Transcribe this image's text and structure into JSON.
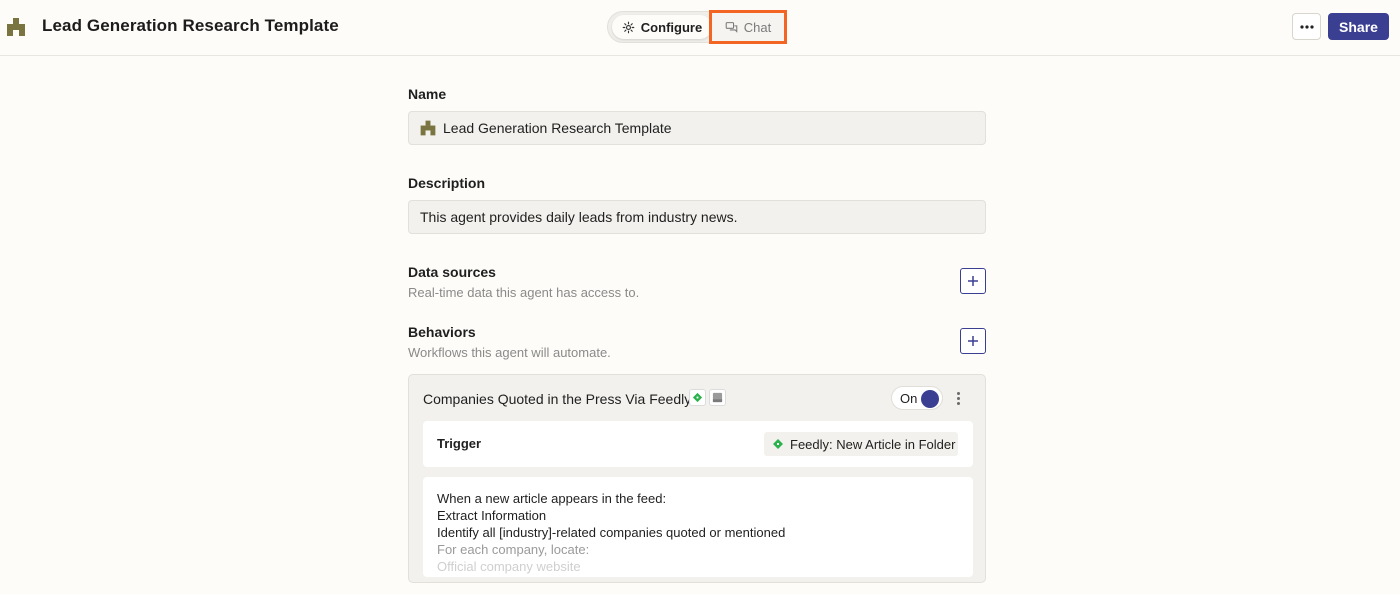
{
  "header": {
    "title": "Lead Generation Research Template",
    "configure_label": "Configure",
    "chat_label": "Chat",
    "share_label": "Share",
    "accent_color": "#3b3f92",
    "highlight_color": "#f26522"
  },
  "form": {
    "name_label": "Name",
    "name_value": "Lead Generation Research Template",
    "description_label": "Description",
    "description_value": "This agent provides daily leads from industry news.",
    "data_sources_label": "Data sources",
    "data_sources_sub": "Real-time data this agent has access to.",
    "behaviors_label": "Behaviors",
    "behaviors_sub": "Workflows this agent will automate."
  },
  "behavior": {
    "title": "Companies Quoted in the Press Via Feedly",
    "toggle_label": "On",
    "toggle_on": true,
    "trigger_label": "Trigger",
    "trigger_value": "Feedly: New Article in Folder",
    "instructions": [
      "When a new article appears in the feed:",
      "Extract Information",
      "Identify all [industry]-related companies quoted or mentioned",
      "For each company, locate:",
      "Official company website"
    ]
  }
}
